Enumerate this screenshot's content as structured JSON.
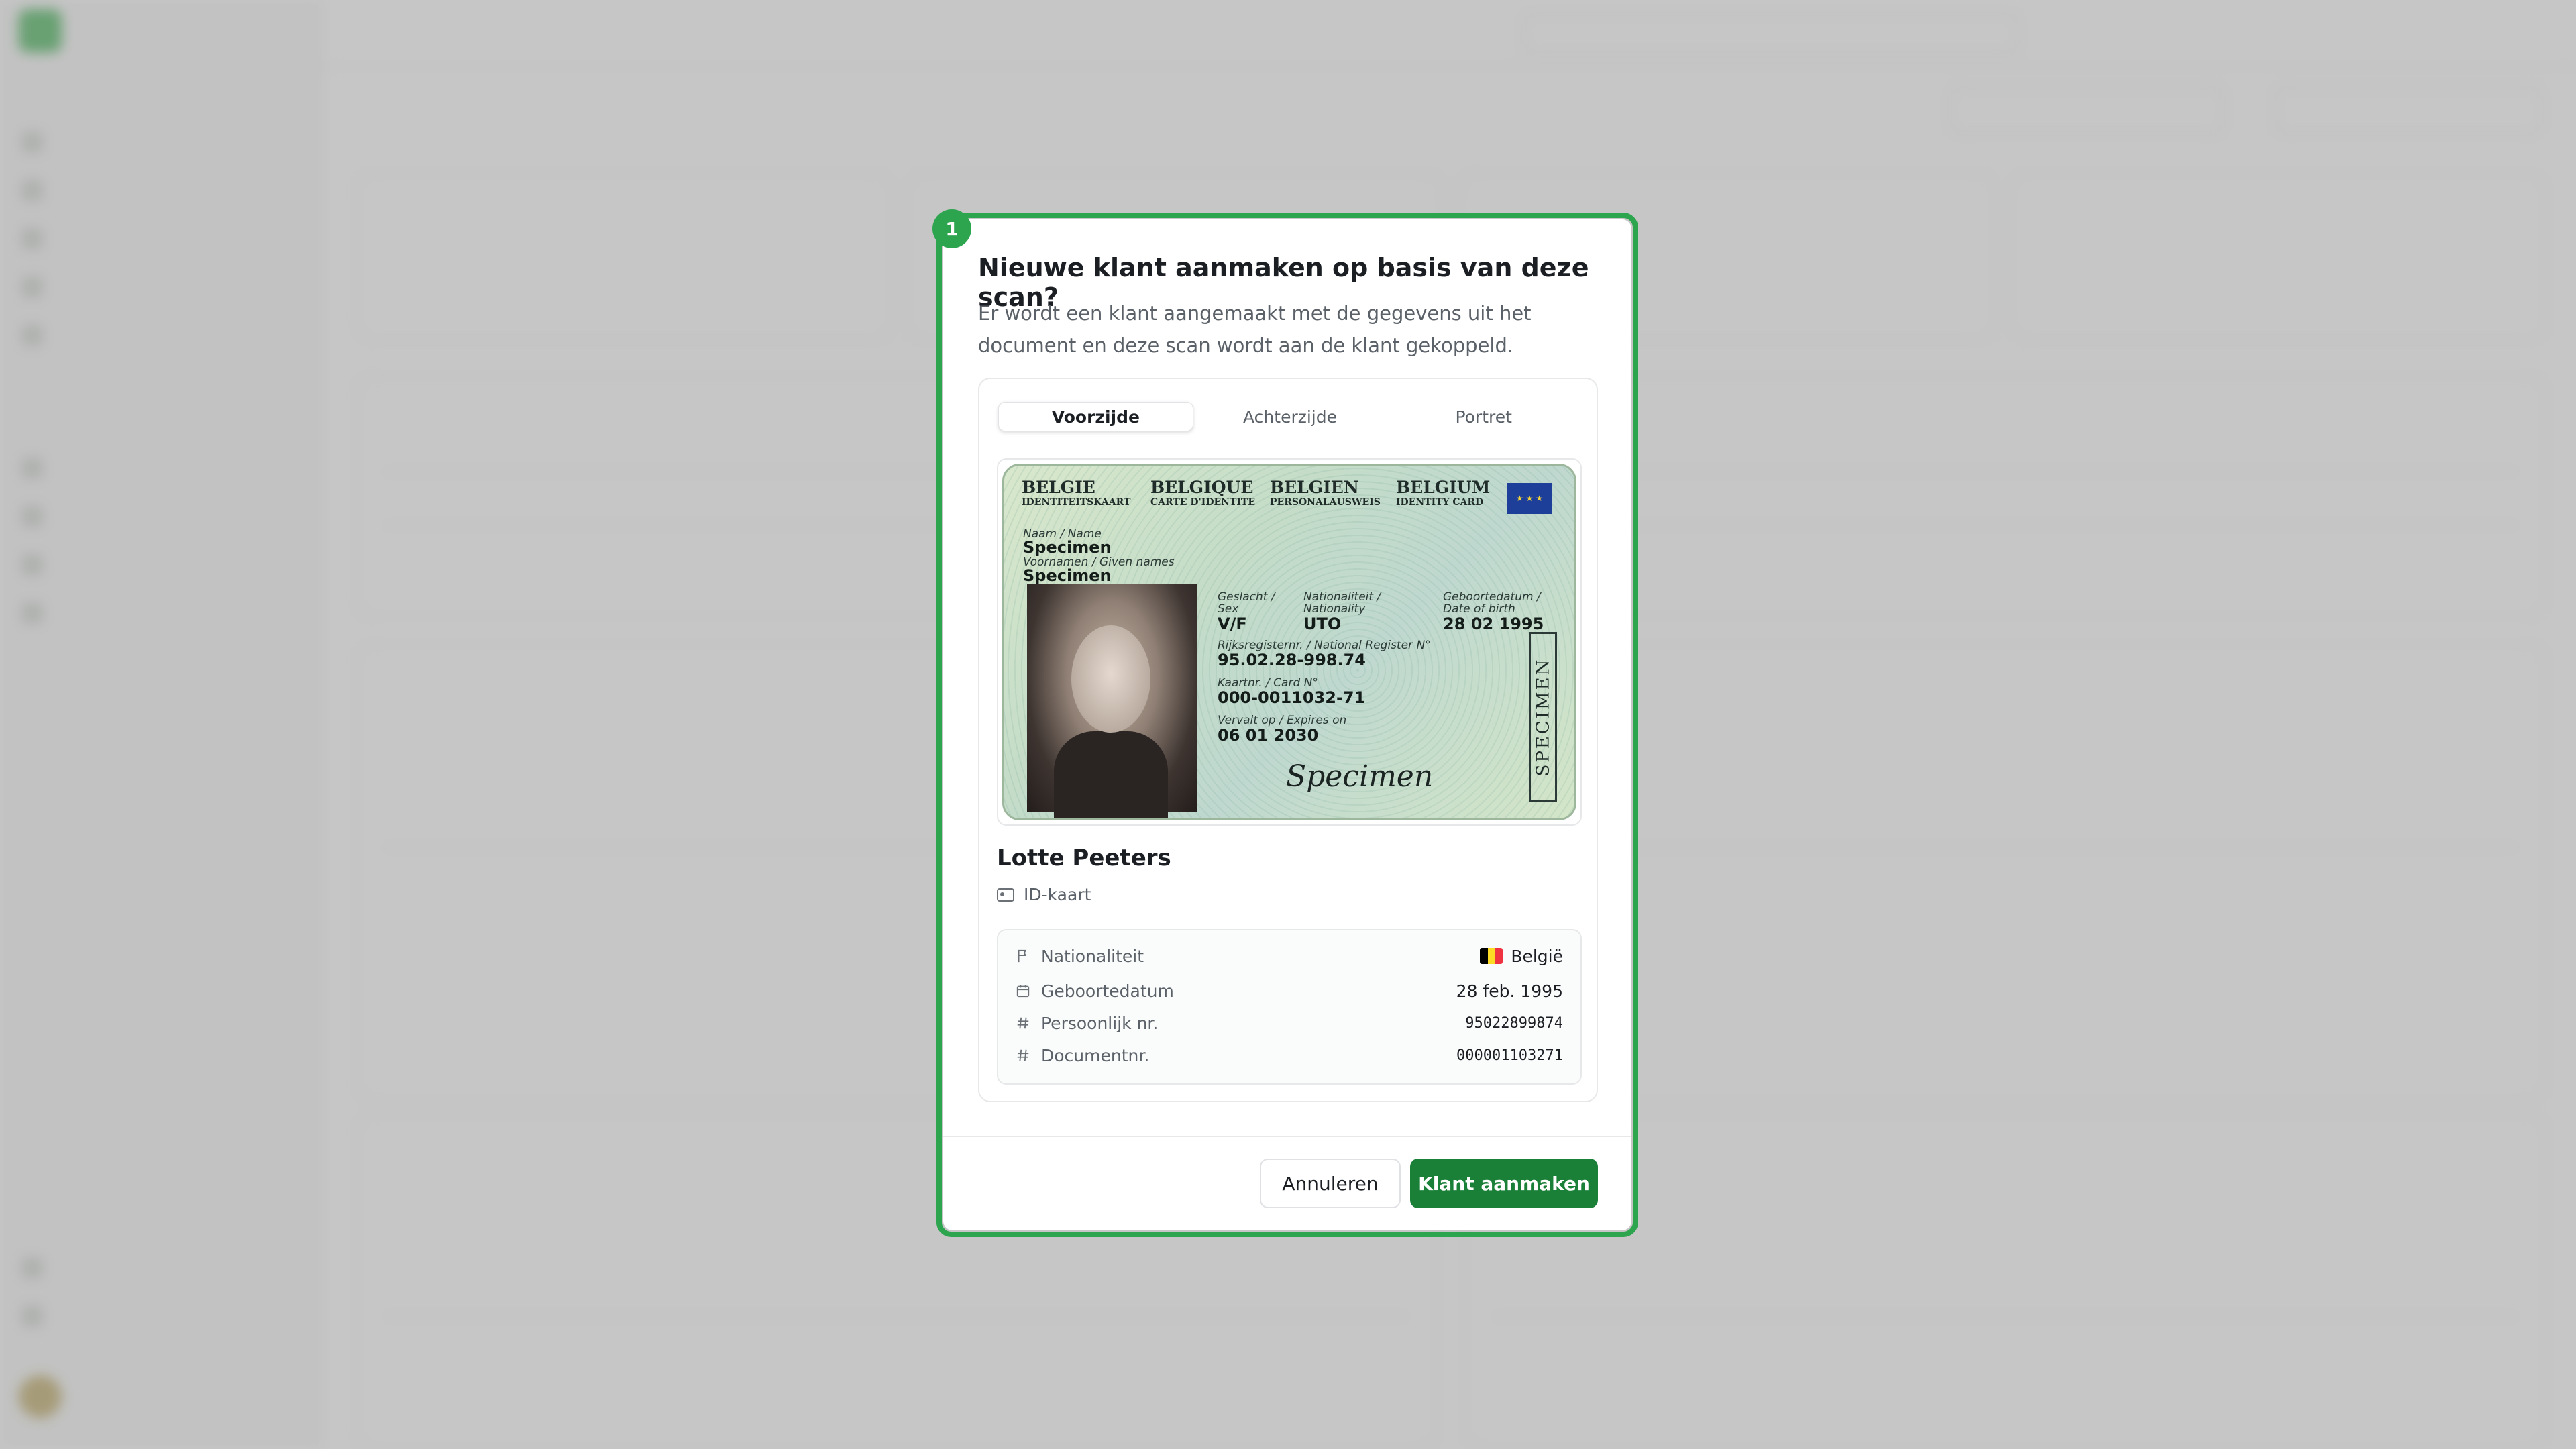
{
  "modal": {
    "step_badge": "1",
    "title": "Nieuwe klant aanmaken op basis van deze scan?",
    "description": "Er wordt een klant aangemaakt met de gegevens uit het document en deze scan wordt aan de klant gekoppeld.",
    "tabs": [
      {
        "label": "Voorzijde",
        "active": true
      },
      {
        "label": "Achterzijde",
        "active": false
      },
      {
        "label": "Portret",
        "active": false
      }
    ],
    "id_card": {
      "countries": [
        "BELGIE",
        "BELGIQUE",
        "BELGIEN",
        "BELGIUM"
      ],
      "card_titles": [
        "IDENTITEITSKAART",
        "CARTE D'IDENTITE",
        "PERSONALAUSWEIS",
        "IDENTITY CARD"
      ],
      "name_label": "Naam / Name",
      "name_value": "Specimen",
      "given_label": "Voornamen / Given names",
      "given_value": "Specimen",
      "sex_label_1": "Geslacht /",
      "sex_label_2": "Sex",
      "sex_value": "V/F",
      "nat_label_1": "Nationaliteit /",
      "nat_label_2": "Nationality",
      "nat_value": "UTO",
      "dob_label_1": "Geboortedatum /",
      "dob_label_2": "Date of birth",
      "dob_value": "28 02 1995",
      "rrn_label": "Rijksregisternr. / National Register N°",
      "rrn_value": "95.02.28-998.74",
      "card_no_label": "Kaartnr. / Card N°",
      "card_no_value": "000-0011032-71",
      "expires_label": "Vervalt op / Expires on",
      "expires_value": "06 01 2030",
      "specimen_stamp": "SPECIMEN",
      "signature": "Specimen"
    },
    "person_name": "Lotte Peeters",
    "document_type": "ID-kaart",
    "details": [
      {
        "icon": "flag-icon",
        "label": "Nationaliteit",
        "value": "België"
      },
      {
        "icon": "calendar-icon",
        "label": "Geboortedatum",
        "value": "28 feb. 1995"
      },
      {
        "icon": "hash-icon",
        "label": "Persoonlijk nr.",
        "value": "95022899874"
      },
      {
        "icon": "hash-icon",
        "label": "Documentnr.",
        "value": "000001103271"
      }
    ],
    "cancel_label": "Annuleren",
    "confirm_label": "Klant aanmaken"
  },
  "colors": {
    "accent": "#2da44e",
    "primary_button": "#1a7f37",
    "belgium_flag": [
      "#000000",
      "#fdda24",
      "#ef3340"
    ]
  }
}
